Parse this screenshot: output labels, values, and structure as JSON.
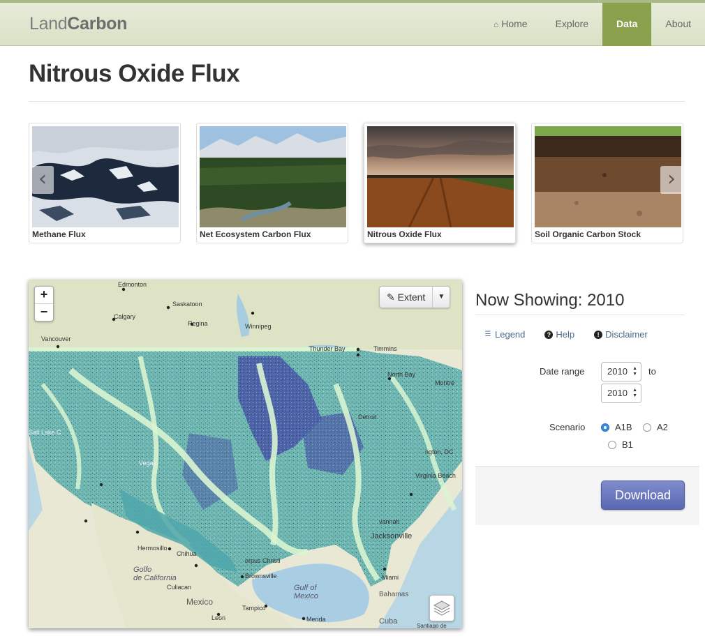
{
  "header": {
    "brand_light": "Land",
    "brand_bold": "Carbon",
    "nav": [
      {
        "label": "Home",
        "icon": "home-icon"
      },
      {
        "label": "Explore"
      },
      {
        "label": "Data",
        "active": true
      },
      {
        "label": "About"
      }
    ]
  },
  "page": {
    "title": "Nitrous Oxide Flux"
  },
  "carousel": {
    "items": [
      {
        "caption": "Methane Flux"
      },
      {
        "caption": "Net Ecosystem Carbon Flux"
      },
      {
        "caption": "Nitrous Oxide Flux",
        "selected": true
      },
      {
        "caption": "Soil Organic Carbon Stock"
      }
    ],
    "prev_icon": "chevron-left-icon",
    "next_icon": "chevron-right-icon"
  },
  "map": {
    "zoom_in": "+",
    "zoom_out": "−",
    "extent_label": "Extent",
    "layers_icon": "layers-icon",
    "labels": {
      "edmonton": "Edmonton",
      "calgary": "Calgary",
      "saskatoon": "Saskatoon",
      "regina": "Regina",
      "winnipeg": "Winnipeg",
      "vancouver": "Vancouver",
      "thunder_bay": "Thunder Bay",
      "timmins": "Timmins",
      "north_bay": "North Bay",
      "montreal": "Montré",
      "detroit": "Detroit",
      "washington": "ngton, DC",
      "salt_lake": "Salt Lake C",
      "vegas": "Vegas",
      "virginia_beach": "Virginia Beach",
      "savannah": "vannah",
      "jacksonville": "Jacksonville",
      "corpus": "orpus Christi",
      "brownsville": "Brownsville",
      "hermosillo": "Hermosillo",
      "chihuahua": "Chihua",
      "culiacan": "Culiacan",
      "golfo": "Golfo\nde California",
      "gulf": "Gulf of\nMexico",
      "miami": "Miami",
      "bahamas": "Bahamas",
      "mexico": "Mexico",
      "tampico": "Tampico",
      "merida": "Merida",
      "leon": "Leon",
      "cuba": "Cuba",
      "santiago": "Santiago de"
    }
  },
  "side": {
    "now_showing": "Now Showing: 2010",
    "links": [
      {
        "label": "Legend",
        "icon": "list-icon"
      },
      {
        "label": "Help",
        "icon": "question-circle-icon"
      },
      {
        "label": "Disclaimer",
        "icon": "exclamation-circle-icon"
      }
    ],
    "date_range_label": "Date range",
    "date_from": "2010",
    "to_label": "to",
    "date_to": "2010",
    "scenario_label": "Scenario",
    "scenarios": [
      {
        "label": "A1B",
        "checked": true
      },
      {
        "label": "A2",
        "checked": false
      },
      {
        "label": "B1",
        "checked": false
      }
    ],
    "download_label": "Download"
  },
  "colors": {
    "accent_green": "#8aa04d",
    "download_blue": "#5f6db5",
    "link": "#4a6a8a"
  }
}
